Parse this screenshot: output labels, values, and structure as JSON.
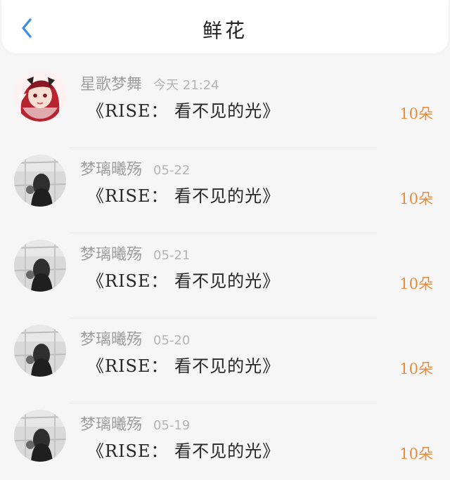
{
  "header": {
    "title": "鲜花",
    "back_icon": "chevron-left-icon",
    "accent_color": "#3a8ee6"
  },
  "records": [
    {
      "username": "星歌梦舞",
      "time": "今天 21:24",
      "gift": "《RISE： 看不见的光》",
      "count": "10朵",
      "avatar": "anime-avatar"
    },
    {
      "username": "梦璃曦殇",
      "time": "05-22",
      "gift": "《RISE： 看不见的光》",
      "count": "10朵",
      "avatar": "photo-avatar"
    },
    {
      "username": "梦璃曦殇",
      "time": "05-21",
      "gift": "《RISE： 看不见的光》",
      "count": "10朵",
      "avatar": "photo-avatar"
    },
    {
      "username": "梦璃曦殇",
      "time": "05-20",
      "gift": "《RISE： 看不见的光》",
      "count": "10朵",
      "avatar": "photo-avatar"
    },
    {
      "username": "梦璃曦殇",
      "time": "05-19",
      "gift": "《RISE： 看不见的光》",
      "count": "10朵",
      "avatar": "photo-avatar"
    }
  ],
  "colors": {
    "count": "#e98c3a",
    "username": "#9d9d9d",
    "gift": "#262626"
  }
}
